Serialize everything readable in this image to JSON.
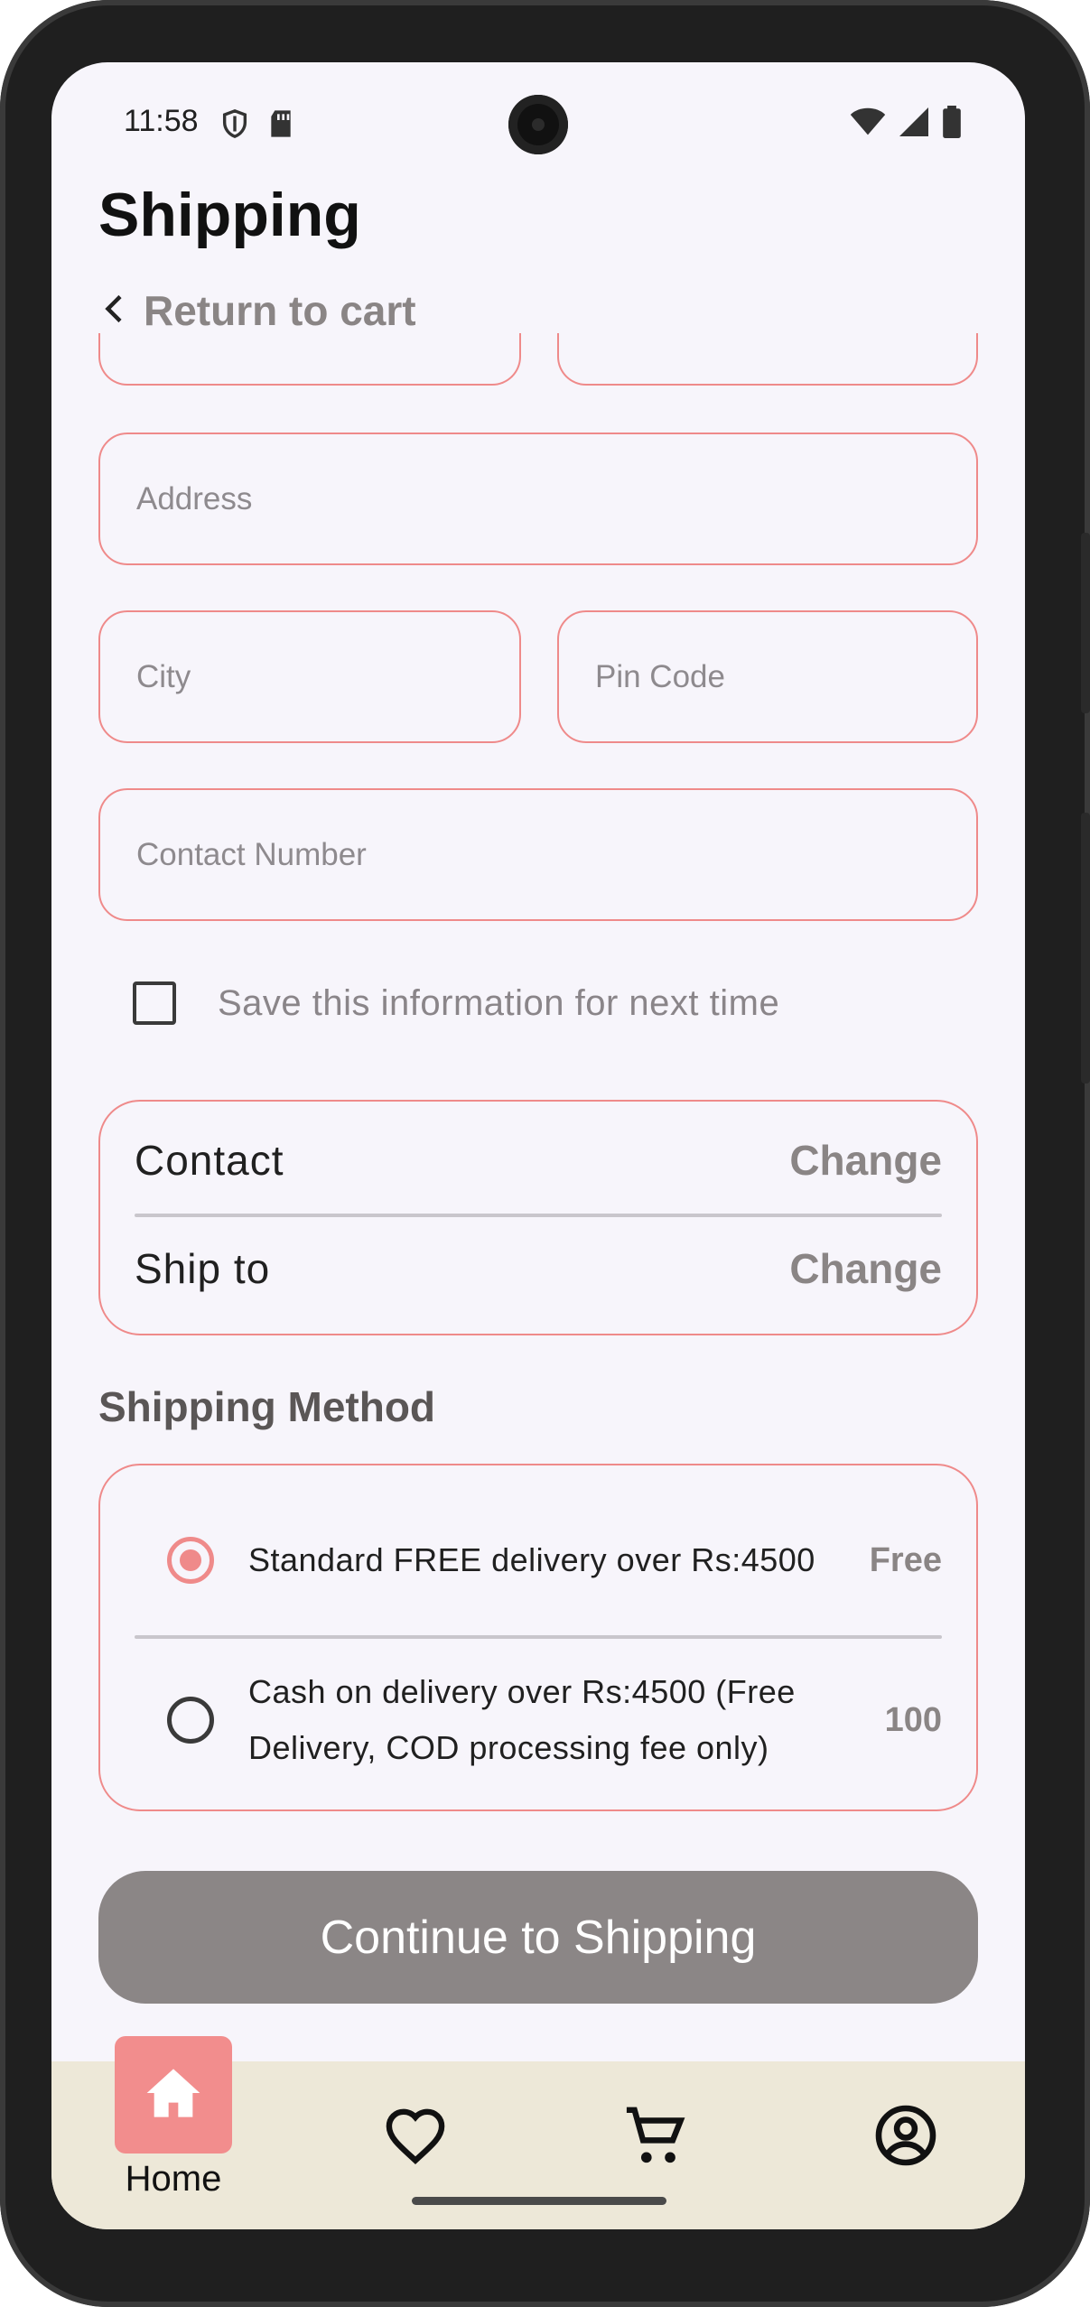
{
  "status_bar": {
    "time": "11:58"
  },
  "header": {
    "title": "Shipping",
    "back_label": "Return to cart"
  },
  "form": {
    "address_placeholder": "Address",
    "city_placeholder": "City",
    "pin_placeholder": "Pin Code",
    "contact_placeholder": "Contact Number",
    "save_info_label": "Save this information for next time",
    "save_info_checked": false
  },
  "summary": {
    "contact_label": "Contact",
    "ship_to_label": "Ship to",
    "change_label": "Change"
  },
  "shipping_method": {
    "title": "Shipping Method",
    "options": [
      {
        "label": "Standard FREE delivery over Rs:4500",
        "price": "Free",
        "selected": true
      },
      {
        "label_line1": "Cash on delivery over Rs:4500 (Free",
        "label_line2": "Delivery, COD processing fee only)",
        "price": "100",
        "selected": false
      }
    ]
  },
  "continue_button": {
    "label": "Continue to Shipping"
  },
  "bottom_nav": {
    "items": [
      {
        "label": "Home",
        "icon": "home-icon",
        "active": true
      },
      {
        "icon": "heart-icon"
      },
      {
        "icon": "cart-icon"
      },
      {
        "icon": "account-icon"
      }
    ]
  },
  "colors": {
    "accent": "#ef8a8a",
    "button": "#8b8686",
    "nav_bg": "#ede8d8",
    "screen_bg": "#f7f5fb"
  }
}
